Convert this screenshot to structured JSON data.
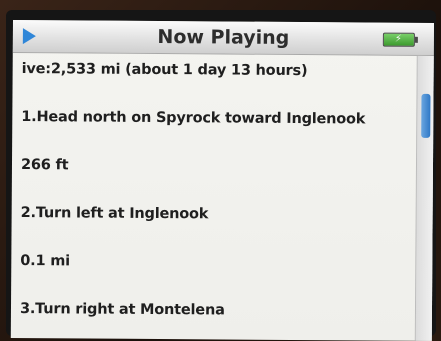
{
  "header": {
    "title": "Now Playing"
  },
  "icons": {
    "play": "play-icon",
    "battery": "battery-icon",
    "charging": "⚡"
  },
  "lines": [
    "ive:2,533  mi  (about  1 day 13 hours)",
    "1.Head north on Spyrock toward Inglenook",
    "266  ft",
    "2.Turn left at Inglenook",
    "0.1  mi",
    "3.Turn right at Montelena"
  ],
  "colors": {
    "accent": "#2f86d8",
    "battery": "#3c9a2e"
  }
}
